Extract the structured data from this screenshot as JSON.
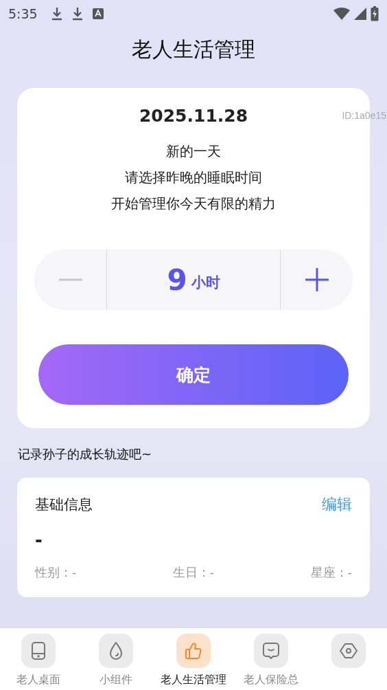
{
  "status_bar": {
    "time": "5:35"
  },
  "title": "老人生活管理",
  "sleep_card": {
    "date": "2025.11.28",
    "id": "ID:1a0e15",
    "message": [
      "新的一天",
      "请选择昨晚的睡眠时间",
      "开始管理你今天有限的精力"
    ],
    "stepper": {
      "value": "9",
      "unit": "小时",
      "decrement_disabled": true,
      "increment_disabled": false
    },
    "confirm_button": "确定"
  },
  "prompt": "记录孙子的成长轨迹吧~",
  "info_card": {
    "title": "基础信息",
    "edit": "编辑",
    "name": "-",
    "fields": [
      {
        "label": "性别：",
        "value": "-"
      },
      {
        "label": "生日：",
        "value": "-"
      },
      {
        "label": "星座：",
        "value": "-"
      }
    ]
  },
  "bottom_nav": [
    {
      "label": "老人桌面",
      "selected": false
    },
    {
      "label": "小组件",
      "selected": false
    },
    {
      "label": "老人生活管理",
      "selected": true
    },
    {
      "label": "老人保险总",
      "selected": false
    },
    {
      "selected": false
    }
  ]
}
